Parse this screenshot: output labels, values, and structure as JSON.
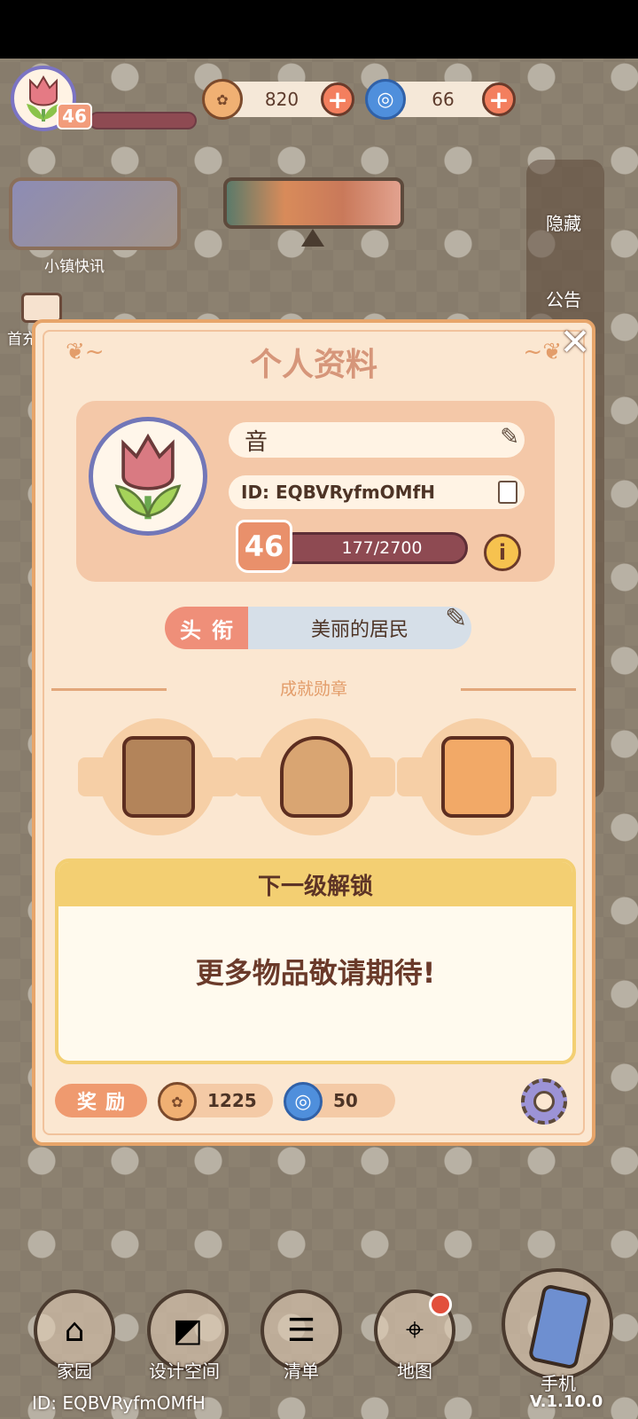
{
  "hud": {
    "level": "46",
    "coins": "820",
    "gems": "66"
  },
  "left": {
    "news_label": "小镇快讯",
    "first_recharge_label": "首充"
  },
  "side": {
    "hide_label": "隐藏",
    "announcement_label": "公告"
  },
  "dialog": {
    "title": "个人资料",
    "close_icon": "close-icon",
    "name": "音",
    "id_text": "ID: EQBVRyfmOMfH",
    "level": "46",
    "xp_text": "177/2700",
    "title_tag": "头衔",
    "title_value": "美丽的居民",
    "achievements_label": "成就勋章",
    "next_unlock_heading": "下一级解锁",
    "next_unlock_body": "更多物品敬请期待!",
    "reward_label": "奖励",
    "reward_coins": "1225",
    "reward_gems": "50"
  },
  "nav": {
    "home": "家园",
    "design": "设计空间",
    "list": "清单",
    "map": "地图",
    "phone": "手机"
  },
  "footer": {
    "id_text": "ID: EQBVRyfmOMfH",
    "version": "V.1.10.0"
  },
  "colors": {
    "dialog_bg": "#fbe7d1",
    "dialog_border": "#e7a56a",
    "accent": "#ef8f79",
    "xp_bar": "#8e4a52"
  }
}
